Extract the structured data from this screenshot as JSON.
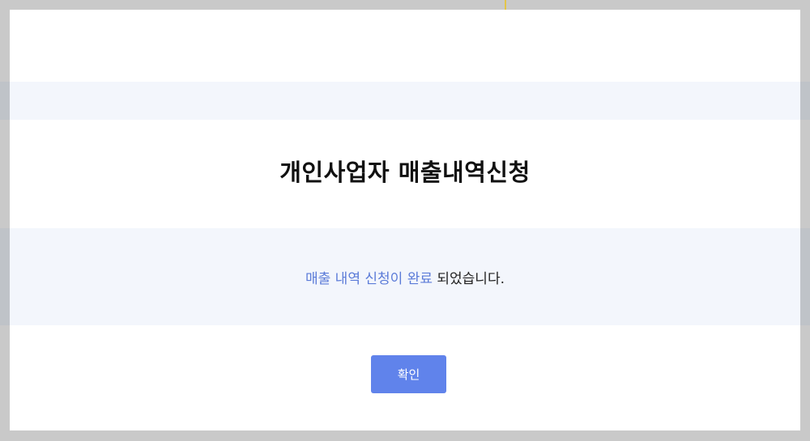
{
  "dialog": {
    "title": "개인사업자 매출내역신청",
    "message_highlight": "매출 내역 신청이 완료",
    "message_rest": " 되었습니다.",
    "confirm_label": "확인"
  },
  "colors": {
    "backdrop": "#c9c9c9",
    "band": "#f3f6fc",
    "highlight_text": "#5b7bd8",
    "button": "#6083eb"
  }
}
